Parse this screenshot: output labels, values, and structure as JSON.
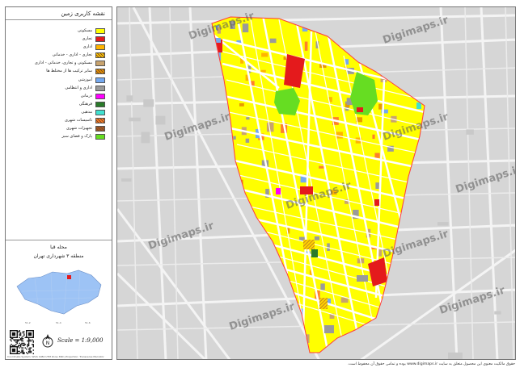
{
  "legend": {
    "title": "نقشه کاربری زمین",
    "items": [
      {
        "label": "مسکونی",
        "color": "#ffff00",
        "pattern": "solid"
      },
      {
        "label": "تجاری",
        "color": "#e41a1c",
        "pattern": "solid"
      },
      {
        "label": "اداری",
        "color": "#ffb400",
        "pattern": "solid"
      },
      {
        "label": "تجاری - اداری - خدماتی",
        "color": "#ffd200",
        "pattern": "hatch"
      },
      {
        "label": "مسکونی و تجاری، خدماتی - اداری",
        "color": "#c8a36e",
        "pattern": "solid"
      },
      {
        "label": "سایر ترکیب ها از مختلط ها",
        "color": "#e89a00",
        "pattern": "hatch"
      },
      {
        "label": "آموزشی",
        "color": "#74a9f0",
        "pattern": "solid"
      },
      {
        "label": "اداری و انتظامی",
        "color": "#9a9a9a",
        "pattern": "solid"
      },
      {
        "label": "درمانی",
        "color": "#ff00ff",
        "pattern": "solid"
      },
      {
        "label": "فرهنگی",
        "color": "#2a7a2a",
        "pattern": "solid"
      },
      {
        "label": "مذهبی",
        "color": "#40e0d0",
        "pattern": "solid"
      },
      {
        "label": "تاسیسات شهری",
        "color": "#ff7f2a",
        "pattern": "hatch"
      },
      {
        "label": "تجهیزات شهری",
        "color": "#a05a2c",
        "pattern": "hatch"
      },
      {
        "label": "پارک و فضای سبز",
        "color": "#66dd22",
        "pattern": "solid"
      }
    ],
    "area_name": "محله قبا",
    "area_region": "منطقه ۳ شهرداری تهران",
    "scale": "Scale = 1:9,000",
    "north_label": "N",
    "footer": "Coordinate System: WGS 1984 UTM Zone 39N | Projection: Transverse Mercator"
  },
  "map": {
    "watermark": "Digimaps.ir",
    "boundary_color": "#ff3b3b",
    "background_color": "#d6d6d6",
    "road_color": "#ffffff",
    "residential_color": "#ffff00"
  },
  "copyright": "حقوق مالکیت معنوی این محصول متعلق به سایت www.digimaps.ir بوده و تمامی حقوق آن محفوظ است."
}
